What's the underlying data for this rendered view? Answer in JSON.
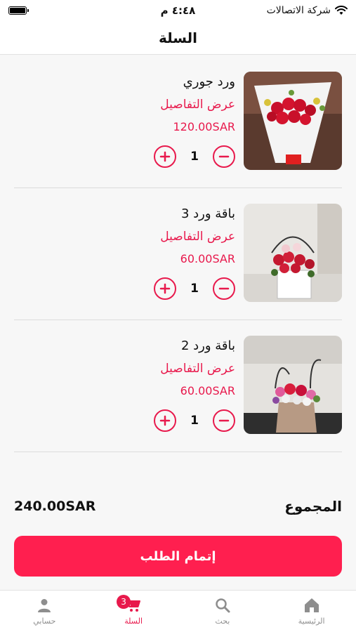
{
  "status_bar": {
    "carrier": "شركة الاتصالات",
    "time": "٤:٤٨ م"
  },
  "header": {
    "title": "السلة"
  },
  "cart": {
    "details_label": "عرض التفاصيل",
    "items": [
      {
        "name": "ورد جوري",
        "price": "120.00SAR",
        "quantity": "1"
      },
      {
        "name": "باقة ورد 3",
        "price": "60.00SAR",
        "quantity": "1"
      },
      {
        "name": "باقة ورد 2",
        "price": "60.00SAR",
        "quantity": "1"
      }
    ]
  },
  "summary": {
    "total_label": "المجموع",
    "total_value": "240.00SAR"
  },
  "checkout": {
    "label": "إتمام الطلب"
  },
  "tab_bar": {
    "items": [
      {
        "label": "حسابي",
        "icon": "person-icon"
      },
      {
        "label": "السلة",
        "icon": "cart-icon",
        "badge": "3",
        "active": true
      },
      {
        "label": "بحث",
        "icon": "search-icon"
      },
      {
        "label": "الرئيسية",
        "icon": "home-icon"
      }
    ]
  },
  "colors": {
    "accent": "#e8194c",
    "button": "#ff1f4f",
    "inactive": "#8e8e8e"
  }
}
